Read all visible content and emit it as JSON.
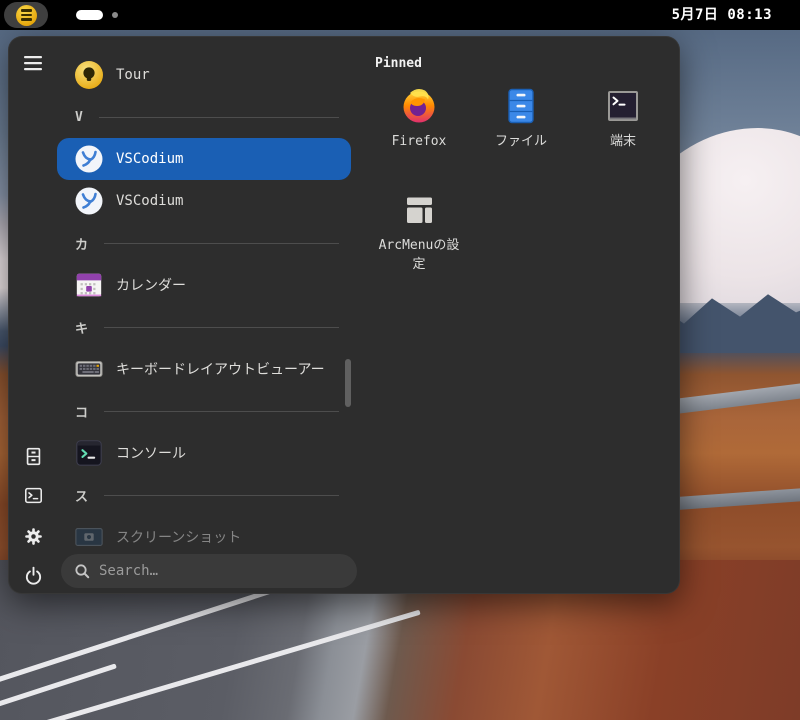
{
  "topbar": {
    "clock": "5月7日 08:13"
  },
  "menu": {
    "app_list": {
      "rows": [
        {
          "type": "item",
          "label": "Tour",
          "icon": "tour-icon"
        },
        {
          "type": "section",
          "label": "V"
        },
        {
          "type": "item",
          "label": "VSCodium",
          "icon": "vscodium-icon",
          "selected": true
        },
        {
          "type": "item",
          "label": "VSCodium",
          "icon": "vscodium-icon"
        },
        {
          "type": "section",
          "label": "カ"
        },
        {
          "type": "item",
          "label": "カレンダー",
          "icon": "calendar-icon"
        },
        {
          "type": "section",
          "label": "キ"
        },
        {
          "type": "item",
          "label": "キーボードレイアウトビューアー",
          "icon": "keyboard-icon"
        },
        {
          "type": "section",
          "label": "コ"
        },
        {
          "type": "item",
          "label": "コンソール",
          "icon": "console-icon"
        },
        {
          "type": "section",
          "label": "ス"
        },
        {
          "type": "item",
          "label": "スクリーンショット",
          "icon": "screenshot-icon",
          "disabled": true
        }
      ]
    },
    "search": {
      "placeholder": "Search…"
    },
    "pinned": {
      "title": "Pinned",
      "items": [
        {
          "label": "Firefox",
          "icon": "firefox-icon"
        },
        {
          "label": "ファイル",
          "icon": "files-icon"
        },
        {
          "label": "端末",
          "icon": "terminal-icon"
        },
        {
          "label": "ArcMenuの設定",
          "icon": "arcmenu-settings-icon"
        }
      ]
    },
    "sidebar_icons": [
      "hamburger-icon",
      "documents-icon",
      "terminal-icon",
      "settings-icon",
      "power-icon"
    ]
  },
  "colors": {
    "accent_selected": "#1a5fb4",
    "panel_bg": "#2d2d2d",
    "topbar_bg": "#000000",
    "arcmenu_button_yellow": "#e5a50a"
  }
}
